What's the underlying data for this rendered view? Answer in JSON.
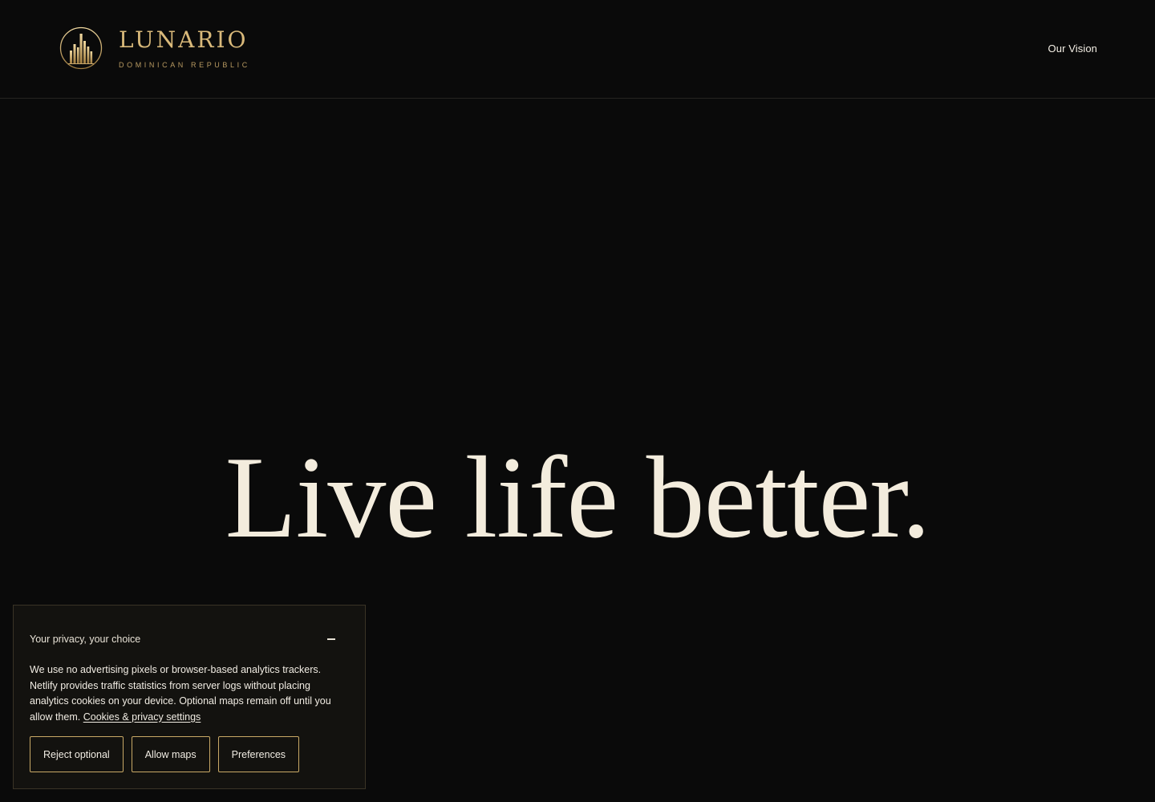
{
  "header": {
    "brand": {
      "name": "LUNARIO",
      "subtitle": "DOMINICAN REPUBLIC",
      "emblem_icon": "city-skyline-emblem-icon"
    },
    "nav": {
      "items": [
        {
          "label": "Our Vision"
        }
      ]
    }
  },
  "hero": {
    "headline": "Live life better."
  },
  "consent_banner": {
    "title": "Your privacy, your choice",
    "collapse_icon": "minus-icon",
    "body": "We use no advertising pixels or browser-based analytics trackers. Netlify provides traffic statistics from server logs without placing analytics cookies on your device. Optional maps remain off until you allow them.",
    "link_label": "Cookies & privacy settings",
    "buttons": {
      "reject": "Reject optional",
      "allow_maps": "Allow maps",
      "preferences": "Preferences"
    }
  },
  "colors": {
    "background": "#0a0a0a",
    "gold_accent": "#d9b97a",
    "headline_cream": "#f3ecdd",
    "banner_background": "#13120f",
    "button_border": "#c9a966"
  }
}
